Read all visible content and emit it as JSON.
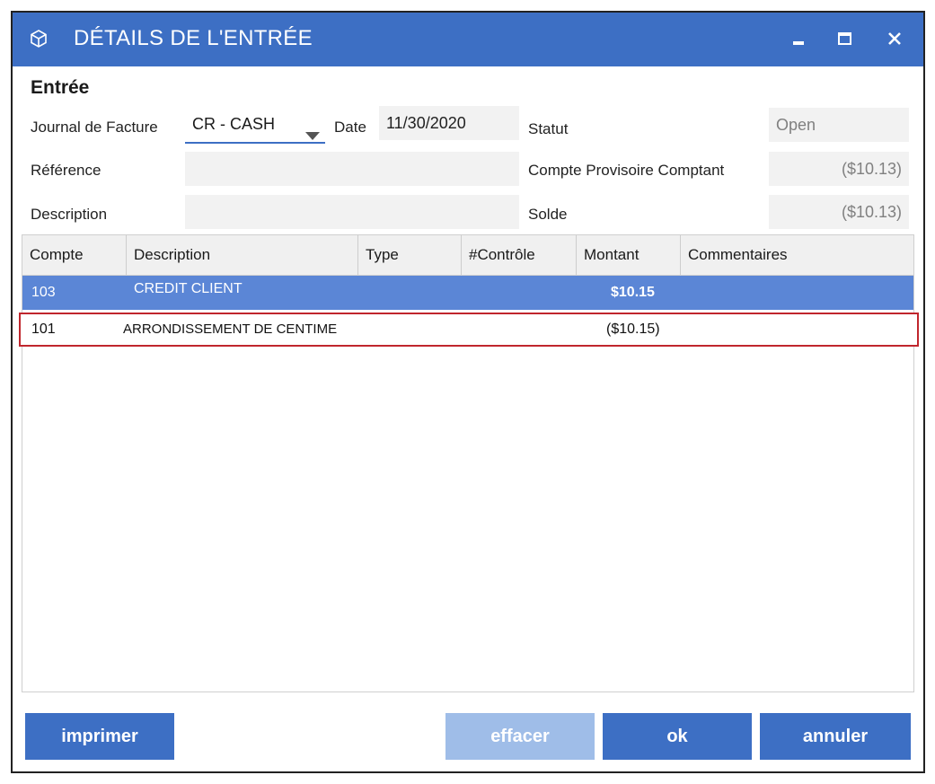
{
  "window": {
    "title": "DÉTAILS DE L'ENTRÉE",
    "icons": [
      "cube-icon",
      "minimize-icon",
      "maximize-icon",
      "close-icon"
    ]
  },
  "entry": {
    "section_title": "Entrée",
    "journal_label": "Journal de Facture",
    "journal_value": "CR - CASH",
    "date_label": "Date",
    "date_value": "11/30/2020",
    "reference_label": "Référence",
    "reference_value": "",
    "description_label": "Description",
    "description_value": "",
    "status_label": "Statut",
    "status_value": "Open",
    "compte_label": "Compte Provisoire Comptant",
    "compte_value": "($10.13)",
    "solde_label": "Solde",
    "solde_value": "($10.13)"
  },
  "grid": {
    "columns": [
      "Compte",
      "Description",
      "Type",
      "#Contrôle",
      "Montant",
      "Commentaires"
    ],
    "rows": [
      {
        "compte": "103",
        "description": "CREDIT CLIENT",
        "type": "",
        "controle": "",
        "montant": "$10.15",
        "commentaires": ""
      },
      {
        "compte": "101",
        "description": "ARRONDISSEMENT DE CENTIME",
        "type": "",
        "controle": "",
        "montant": "($10.15)",
        "commentaires": ""
      }
    ]
  },
  "buttons": {
    "print": "imprimer",
    "clear": "effacer",
    "ok": "ok",
    "cancel": "annuler"
  },
  "colors": {
    "accent": "#3d6fc4",
    "selected_row": "#5b86d6",
    "highlight_border": "#c0262d",
    "disabled_button": "#9fbde8"
  }
}
